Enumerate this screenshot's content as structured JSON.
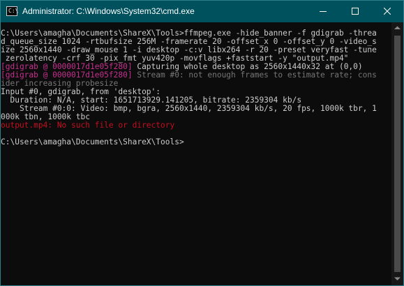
{
  "window": {
    "title": "Administrator: C:\\Windows\\System32\\cmd.exe",
    "icon": "cmd-icon",
    "icon_glyph": "C:\\",
    "titlebar_color": "#00515e"
  },
  "console": {
    "lines": [
      {
        "segments": [
          {
            "text": "C:\\Users\\amagha\\Documents\\ShareX\\Tools>ffmpeg.exe -hide_banner -f gdigrab -threa",
            "color": "default"
          }
        ]
      },
      {
        "segments": [
          {
            "text": "d_queue_size 1024 -rtbufsize 256M -framerate 20 -offset_x 0 -offset_y 0 -video_s",
            "color": "default"
          }
        ]
      },
      {
        "segments": [
          {
            "text": "ize 2560x1440 -draw_mouse 1 -i desktop -c:v libx264 -r 20 -preset veryfast -tune",
            "color": "default"
          }
        ]
      },
      {
        "segments": [
          {
            "text": " zerolatency -crf 30 -pix_fmt yuv420p -movflags +faststart -y \"output.mp4\"",
            "color": "default"
          }
        ]
      },
      {
        "segments": [
          {
            "text": "[gdigrab @ 0000017d1e05f280]",
            "color": "pink"
          },
          {
            "text": " Capturing whole desktop as 2560x1440x32 at (0,0)",
            "color": "default"
          }
        ]
      },
      {
        "segments": [
          {
            "text": "[gdigrab @ 0000017d1e05f280]",
            "color": "pink"
          },
          {
            "text": " Stream #0: not enough frames to estimate rate; cons",
            "color": "gray"
          }
        ]
      },
      {
        "segments": [
          {
            "text": "ider increasing probesize",
            "color": "gray"
          }
        ]
      },
      {
        "segments": [
          {
            "text": "Input #0, gdigrab, from 'desktop':",
            "color": "default"
          }
        ]
      },
      {
        "segments": [
          {
            "text": "  Duration: N/A, start: 1651713929.141205, bitrate: 2359304 kb/s",
            "color": "default"
          }
        ]
      },
      {
        "segments": [
          {
            "text": "    Stream #0:0: Video: bmp, bgra, 2560x1440, 2359304 kb/s, 20 fps, 1000k tbr, 1",
            "color": "default"
          }
        ]
      },
      {
        "segments": [
          {
            "text": "000k tbn, 1000k tbc",
            "color": "default"
          }
        ]
      },
      {
        "segments": [
          {
            "text": "output.mp4: No such file or directory",
            "color": "red"
          }
        ]
      },
      {
        "segments": [
          {
            "text": "",
            "color": "default"
          }
        ]
      },
      {
        "segments": [
          {
            "text": "C:\\Users\\amagha\\Documents\\ShareX\\Tools>",
            "color": "default"
          }
        ]
      }
    ]
  },
  "colors": {
    "console_bg": "#0c0c0c",
    "default_text": "#cccccc",
    "pink": "#c62f8f",
    "gray": "#767676",
    "red": "#c50f1f"
  }
}
